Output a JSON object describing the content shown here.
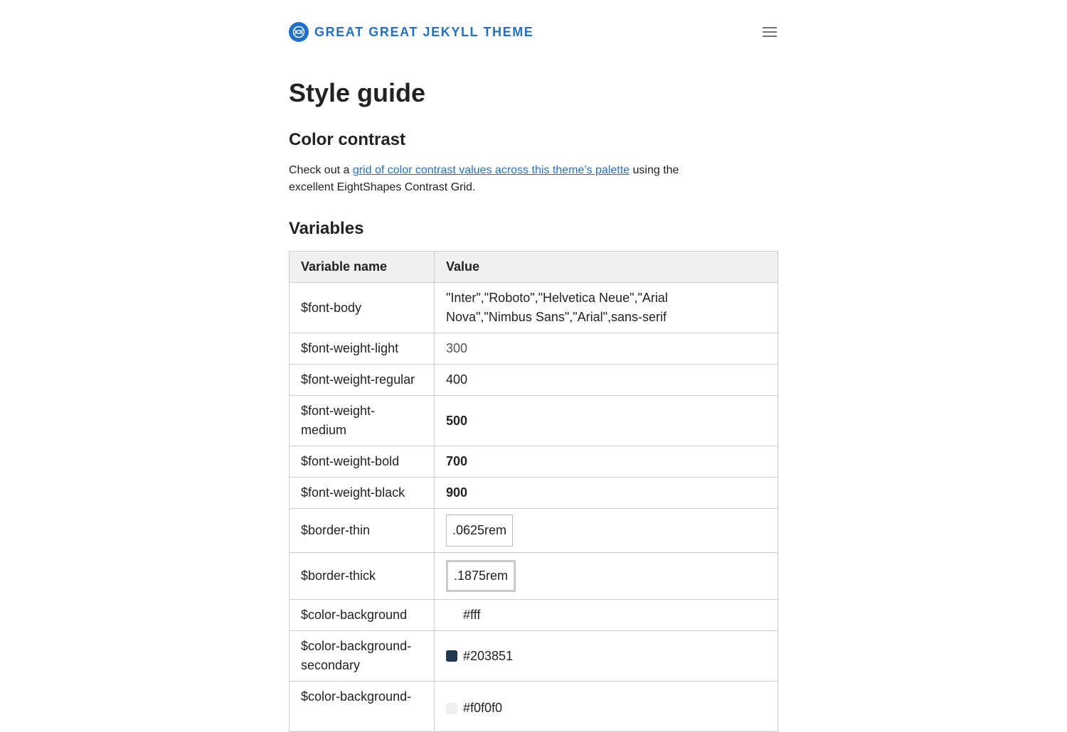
{
  "header": {
    "site_title": "GREAT GREAT JEKYLL THEME",
    "logo_icon": "pretzel-logo-icon",
    "menu_icon": "hamburger-menu-icon"
  },
  "main": {
    "page_title": "Style guide",
    "contrast": {
      "heading": "Color contrast",
      "text_before": "Check out a ",
      "link_text": "grid of color contrast values across this theme’s palette",
      "text_after": " using the excellent EightShapes Contrast Grid."
    },
    "variables": {
      "heading": "Variables",
      "columns": [
        "Variable name",
        "Value"
      ],
      "rows": [
        {
          "name": "$font-body",
          "value": "\"Inter\",\"Roboto\",\"Helvetica Neue\",\"Arial Nova\",\"Nimbus Sans\",\"Arial\",sans-serif"
        },
        {
          "name": "$font-weight-light",
          "value": "300"
        },
        {
          "name": "$font-weight-regular",
          "value": "400"
        },
        {
          "name": "$font-weight-medium",
          "value": "500"
        },
        {
          "name": "$font-weight-bold",
          "value": "700"
        },
        {
          "name": "$font-weight-black",
          "value": "900"
        },
        {
          "name": "$border-thin",
          "value": ".0625rem"
        },
        {
          "name": "$border-thick",
          "value": ".1875rem"
        },
        {
          "name": "$color-background",
          "value": "#fff",
          "swatch": "#ffffff"
        },
        {
          "name": "$color-background-secondary",
          "value": "#203851",
          "swatch": "#203851"
        },
        {
          "name": "$color-background-",
          "value": "#f0f0f0",
          "swatch": "#f0f0f0"
        }
      ]
    }
  },
  "colors": {
    "accent": "#1f6fd0",
    "text": "#222222",
    "border": "#cccccc",
    "table_header_bg": "#f0f0f0"
  }
}
